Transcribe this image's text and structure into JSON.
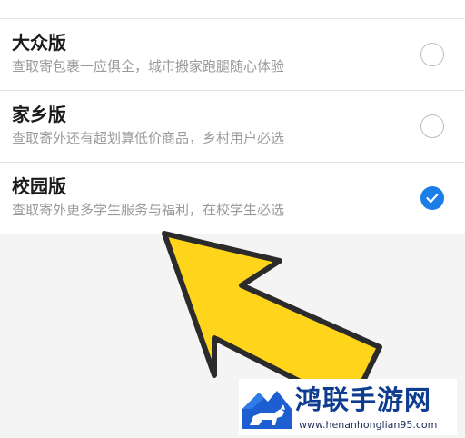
{
  "options": [
    {
      "title": "大众版",
      "desc": "查取寄包裹一应俱全，城市搬家跑腿随心体验",
      "selected": false
    },
    {
      "title": "家乡版",
      "desc": "查取寄外还有超划算低价商品，乡村用户必选",
      "selected": false
    },
    {
      "title": "校园版",
      "desc": "查取寄外更多学生服务与福利，在校学生必选",
      "selected": true
    }
  ],
  "watermark": {
    "title": "鸿联手游网",
    "url": "www.henanhonglian95.com"
  },
  "colors": {
    "accent": "#1a7ee6",
    "arrow_fill": "#ffd51c",
    "arrow_stroke": "#2b2b2b",
    "watermark_text": "#0e3c8f"
  },
  "icons": {
    "check": "checkmark-icon",
    "logo": "horse-mountain-logo-icon"
  }
}
